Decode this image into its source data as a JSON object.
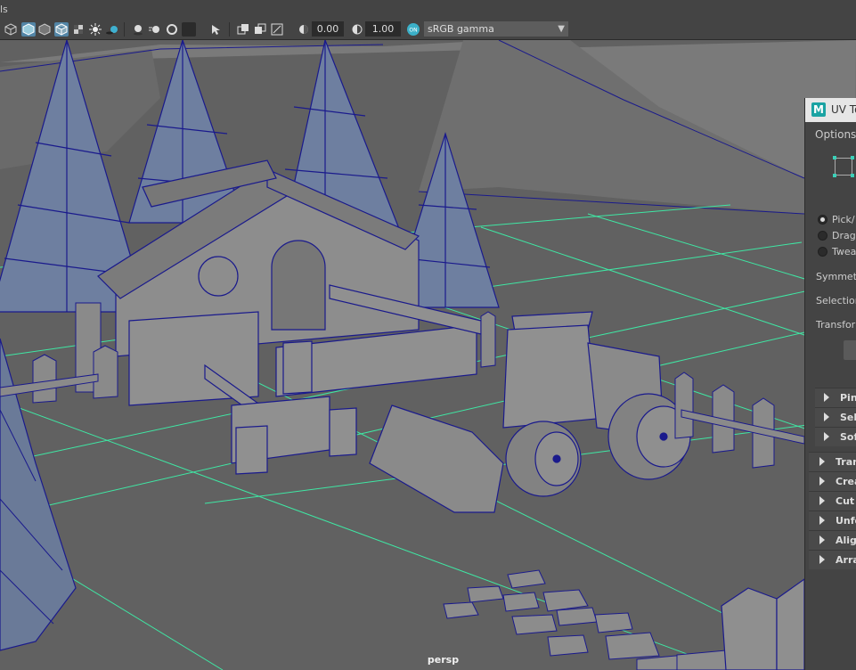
{
  "menubar": {
    "label": "ls"
  },
  "toolbar": {
    "exposure_value": "0.00",
    "gamma_value": "1.00",
    "color_management": "sRGB gamma"
  },
  "viewport": {
    "camera_label": "persp"
  },
  "uv_toolkit": {
    "title": "UV To",
    "menu_options": "Options",
    "radios": [
      "Pick/",
      "Drag",
      "Twea"
    ],
    "rows": [
      "Symmetr",
      "Selection",
      "Transform"
    ],
    "subsections": [
      "Pin",
      "Sele",
      "Sof"
    ],
    "sections": [
      "Trans",
      "Crea",
      "Cut a",
      "Unfo",
      "Align",
      "Arran"
    ]
  },
  "colors": {
    "accent": "#5285a6",
    "wire": "#1a1a8c",
    "grid": "#3fe7a4",
    "panel": "#444444"
  }
}
